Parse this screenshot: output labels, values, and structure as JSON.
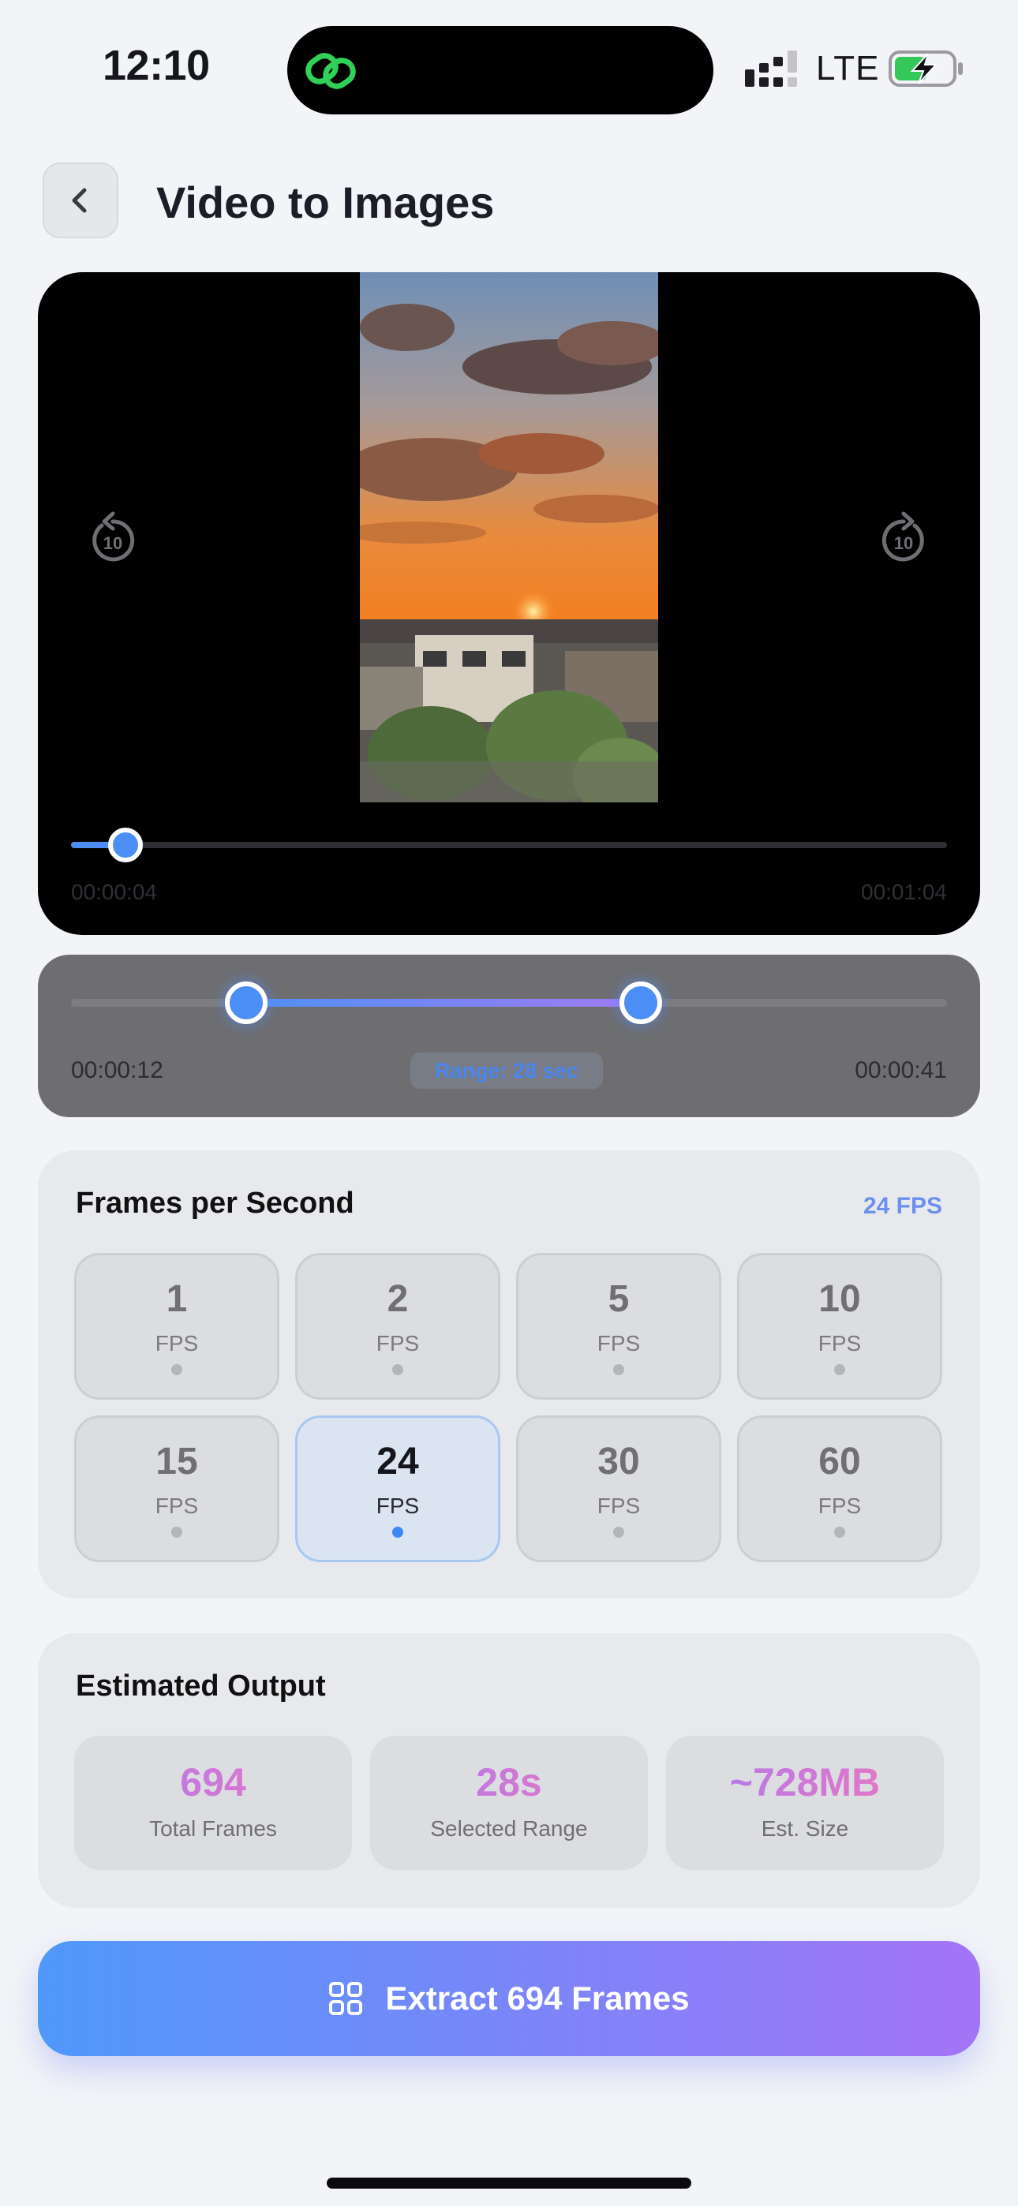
{
  "status_bar": {
    "time": "12:10",
    "network": "LTE",
    "icons": [
      "link-icon",
      "signal-icon",
      "battery-charging-icon"
    ]
  },
  "header": {
    "title": "Video to Images",
    "back_icon": "chevron-left-icon"
  },
  "player": {
    "current_time": "00:00:04",
    "duration": "00:01:04",
    "progress": 0.0625,
    "skip_back_label": "10",
    "skip_forward_label": "10"
  },
  "range": {
    "start_label": "00:00:12",
    "end_label": "00:00:41",
    "badge": "Range: 28 sec",
    "start_fraction": 0.2,
    "end_fraction": 0.65
  },
  "fps": {
    "title": "Frames per Second",
    "current": "24 FPS",
    "unit": "FPS",
    "selected": "24",
    "options": [
      {
        "value": "1",
        "unit": "FPS"
      },
      {
        "value": "2",
        "unit": "FPS"
      },
      {
        "value": "5",
        "unit": "FPS"
      },
      {
        "value": "10",
        "unit": "FPS"
      },
      {
        "value": "15",
        "unit": "FPS"
      },
      {
        "value": "24",
        "unit": "FPS"
      },
      {
        "value": "30",
        "unit": "FPS"
      },
      {
        "value": "60",
        "unit": "FPS"
      }
    ]
  },
  "output": {
    "title": "Estimated Output",
    "stats": [
      {
        "value": "694",
        "label": "Total Frames"
      },
      {
        "value": "28s",
        "label": "Selected Range"
      },
      {
        "value": "~728MB",
        "label": "Est. Size"
      }
    ]
  },
  "extract": {
    "label": "Extract 694 Frames",
    "icon": "grid-icon"
  },
  "colors": {
    "accent_blue": "#4b8ef6",
    "accent_purple": "#a474f6",
    "stat_gradient_start": "#a97af3",
    "stat_gradient_end": "#f177bb"
  }
}
